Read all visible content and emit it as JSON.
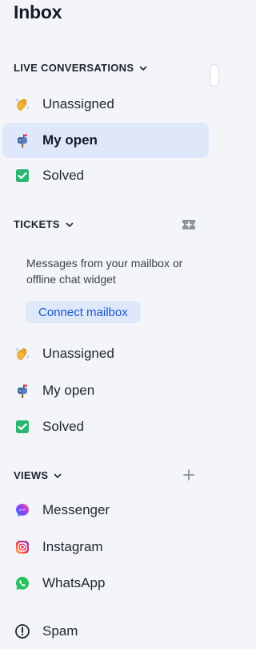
{
  "title": "Inbox",
  "live": {
    "header": "LIVE CONVERSATIONS",
    "items": [
      {
        "label": "Unassigned",
        "icon": "waving-hand-icon"
      },
      {
        "label": "My open",
        "icon": "mailbox-icon",
        "active": true
      },
      {
        "label": "Solved",
        "icon": "check-box-icon"
      }
    ]
  },
  "tickets": {
    "header": "TICKETS",
    "hint": "Messages from your mailbox or offline chat widget",
    "connect_label": "Connect mailbox",
    "items": [
      {
        "label": "Unassigned",
        "icon": "waving-hand-icon"
      },
      {
        "label": "My open",
        "icon": "mailbox-icon"
      },
      {
        "label": "Solved",
        "icon": "check-box-icon"
      }
    ]
  },
  "views": {
    "header": "VIEWS",
    "items": [
      {
        "label": "Messenger",
        "icon": "messenger-icon"
      },
      {
        "label": "Instagram",
        "icon": "instagram-icon"
      },
      {
        "label": "WhatsApp",
        "icon": "whatsapp-icon"
      }
    ]
  },
  "spam": {
    "label": "Spam",
    "icon": "exclamation-circle-icon"
  },
  "colors": {
    "active_bg": "#dfe8fb",
    "accent": "#1e55c4",
    "solved_green": "#2bb673"
  }
}
